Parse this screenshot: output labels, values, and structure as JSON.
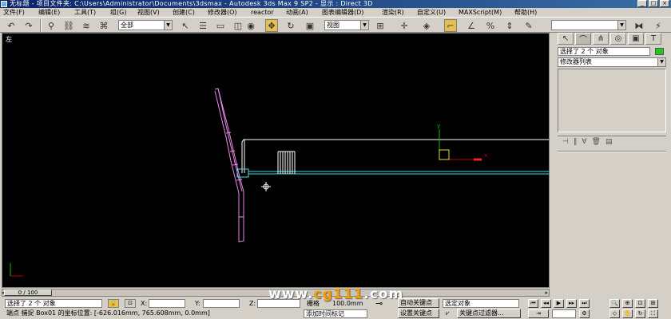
{
  "window": {
    "title": "无标题   - 项目文件夹: C:\\Users\\Administrator\\Documents\\3dsmax    - Autodesk 3ds Max 9 SP2     - 显示 : Direct 3D"
  },
  "menu": [
    "文件(F)",
    "编辑(E)",
    "工具(T)",
    "组(G)",
    "视图(V)",
    "创建(C)",
    "修改器(O)",
    "reactor",
    "动画(A)",
    "图表编辑器(D)",
    "渲染(R)",
    "自定义(U)",
    "MAXScript(M)",
    "帮助(H)"
  ],
  "toolbar": {
    "selection_filter": "全部",
    "coord_system": "视图"
  },
  "viewport": {
    "label": "左",
    "axis_labels": {
      "x": "x",
      "y": "y"
    }
  },
  "command_panel": {
    "object_name": "选择了 2 个 对象",
    "modifier_list": "修改器列表",
    "object_color": "#1ec81e"
  },
  "timeline": {
    "position": "0 / 100",
    "current_frame": 0,
    "total_frames": 100
  },
  "status": {
    "selection": "选择了 2 个 对象",
    "x_label": "X:",
    "y_label": "Y:",
    "z_label": "Z:",
    "grid_label": "栅格",
    "grid_value": "100.0mm",
    "snap_text": "端点 捕捉 Box01 的坐标位置: [-626.016mm, 765.608mm, 0.0mm]",
    "add_time_tag": "添加时间标记",
    "auto_key": "自动关键点",
    "set_key": "设置关键点",
    "selected_object": "选定对象",
    "key_filter": "关键点过滤器..."
  },
  "watermark": {
    "prefix": "www.",
    "brand": "cg111",
    "suffix": ".com"
  }
}
